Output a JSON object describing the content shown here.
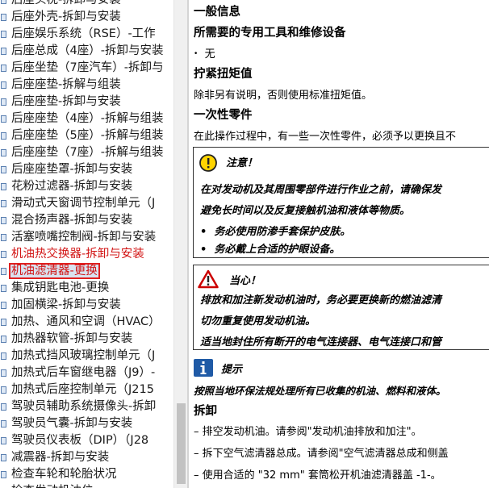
{
  "sidebar": {
    "items": [
      {
        "label": "后座头枕-拆卸与安装",
        "state": "normal"
      },
      {
        "label": "后座外壳-拆卸与安装",
        "state": "normal"
      },
      {
        "label": "后座娱乐系统（RSE）-工作",
        "state": "normal"
      },
      {
        "label": "后座总成（4座）-拆卸与安装",
        "state": "normal"
      },
      {
        "label": "后座坐垫（7座汽车）-拆卸与",
        "state": "normal"
      },
      {
        "label": "后座座垫-拆解与组装",
        "state": "normal"
      },
      {
        "label": "后座座垫-拆卸与安装",
        "state": "normal"
      },
      {
        "label": "后座座垫（4座）-拆解与组装",
        "state": "normal"
      },
      {
        "label": "后座座垫（5座）-拆解与组装",
        "state": "normal"
      },
      {
        "label": "后座座垫（7座）-拆解与组装",
        "state": "normal"
      },
      {
        "label": "后座座垫罩-拆卸与安装",
        "state": "normal"
      },
      {
        "label": "花粉过滤器-拆卸与安装",
        "state": "normal"
      },
      {
        "label": "滑动式天窗调节控制单元（J",
        "state": "normal"
      },
      {
        "label": "混合扬声器-拆卸与安装",
        "state": "normal"
      },
      {
        "label": "活塞喷嘴控制阀-拆卸与安装",
        "state": "normal"
      },
      {
        "label": "机油热交换器-拆卸与安装",
        "state": "red"
      },
      {
        "label": "机油滤清器-更换",
        "state": "selected"
      },
      {
        "label": "集成钥匙电池-更换",
        "state": "normal"
      },
      {
        "label": "加固横梁-拆卸与安装",
        "state": "normal"
      },
      {
        "label": "加热、通风和空调（HVAC）",
        "state": "normal"
      },
      {
        "label": "加热器软管-拆卸与安装",
        "state": "normal"
      },
      {
        "label": "加热式挡风玻璃控制单元（J",
        "state": "normal"
      },
      {
        "label": "加热式后车窗继电器（J9）-",
        "state": "normal"
      },
      {
        "label": "加热式后座控制单元（J215",
        "state": "normal"
      },
      {
        "label": "驾驶员辅助系统摄像头-拆卸",
        "state": "normal"
      },
      {
        "label": "驾驶员气囊-拆卸与安装",
        "state": "normal"
      },
      {
        "label": "驾驶员仪表板（DIP）（J28",
        "state": "normal"
      },
      {
        "label": "减震器-拆卸与安装",
        "state": "normal"
      },
      {
        "label": "检查车轮和轮胎状况",
        "state": "normal"
      },
      {
        "label": "检查发动机油位",
        "state": "normal"
      }
    ]
  },
  "content": {
    "general_info": "一般信息",
    "special_tools_heading": "所需要的专用工具和维修设备",
    "special_tools_value": "无",
    "torque_heading": "拧紧扭矩值",
    "torque_text": "除非另有说明，否则使用标准扭矩值。",
    "one_time_heading": "一次性零件",
    "one_time_text": "在此操作过程中，有一些一次性零件，必须予以更换且不",
    "notice": {
      "title": "注意！",
      "line1": "在对发动机及其周围零部件进行作业之前，请确保发",
      "line2": "避免长时间以及反复接触机油和液体等物质。",
      "bullet1": "务必使用防渗手套保护皮肤。",
      "bullet2": "务必戴上合适的护眼设备。"
    },
    "caution": {
      "title": "当心！",
      "line1": "排放和加注新发动机油时，务必要更换新的燃油滤清",
      "line2": "切勿重复使用发动机油。",
      "line3": "适当地封住所有断开的电气连接器、电气连接口和管"
    },
    "tip": {
      "title": "提示",
      "text": "按照当地环保法规处理所有已收集的机油、燃料和液体。"
    },
    "removal_heading": "拆卸",
    "steps": [
      "排空发动机油。请参阅\"发动机油排放和加注\"。",
      "拆下空气滤清器总成。请参阅\"空气滤清器总成和侧盖",
      "使用合适的 \"32 mm\" 套筒松开机油滤清器盖 -1-。"
    ]
  },
  "colors": {
    "selected_text": "#d21414",
    "selected_border": "#e02020",
    "notice_icon": "#ffd400",
    "caution_icon": "#cc0000",
    "tip_icon": "#1f5aa6"
  }
}
